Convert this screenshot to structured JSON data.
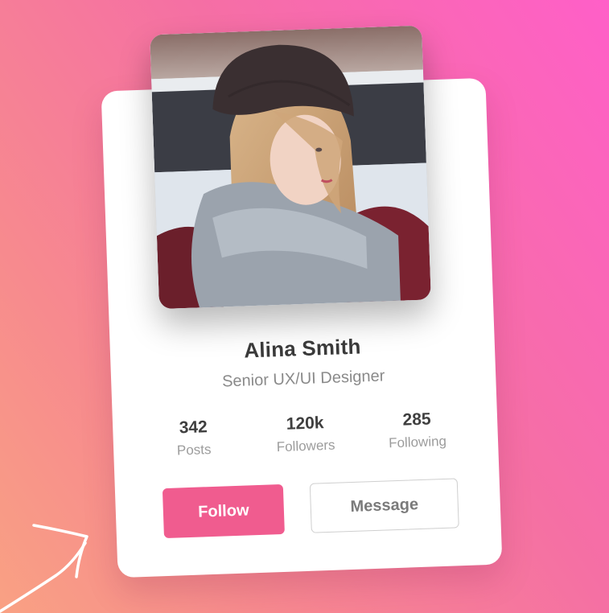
{
  "profile": {
    "name": "Alina Smith",
    "role": "Senior UX/UI Designer"
  },
  "stats": [
    {
      "value": "342",
      "label": "Posts"
    },
    {
      "value": "120k",
      "label": "Followers"
    },
    {
      "value": "285",
      "label": "Following"
    }
  ],
  "actions": {
    "follow_label": "Follow",
    "message_label": "Message"
  },
  "colors": {
    "accent": "#f05c8f",
    "background_top": "#ff5fc8",
    "background_bottom": "#f9a183"
  },
  "icons": {
    "arrow": "hand-drawn-arrow-icon"
  }
}
